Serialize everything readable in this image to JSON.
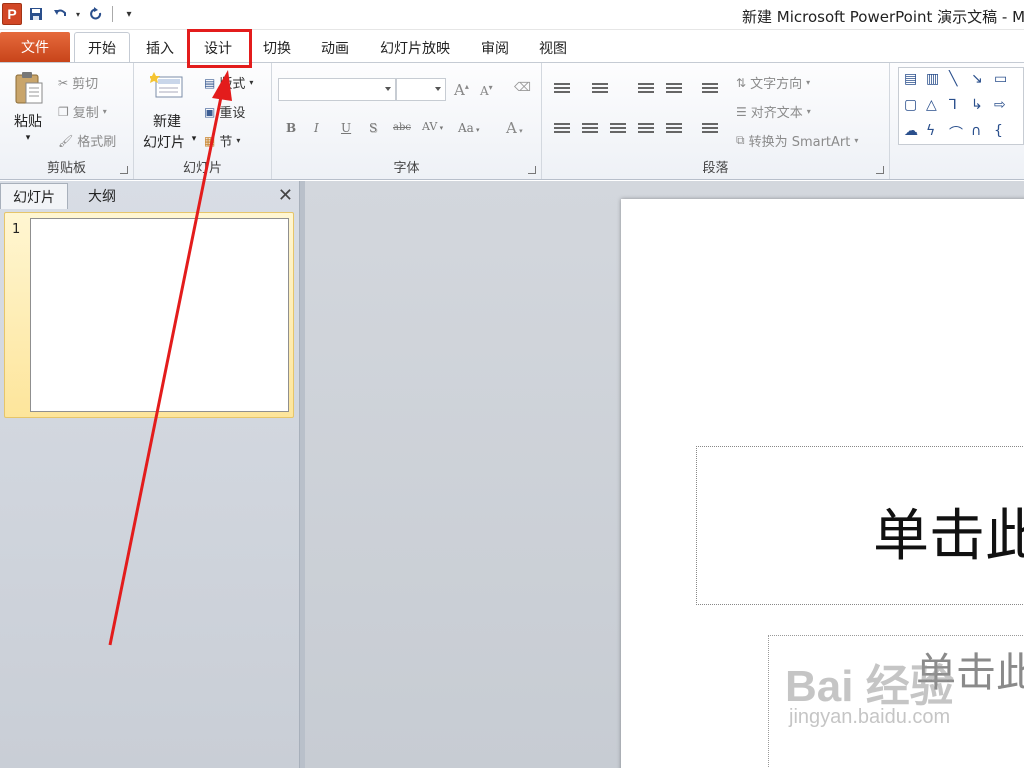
{
  "window": {
    "title": "新建 Microsoft PowerPoint 演示文稿 - M",
    "app_logo": "P"
  },
  "quick_access": {
    "icons": [
      "save-icon",
      "undo-icon",
      "redo-icon",
      "customize-icon"
    ]
  },
  "tabs": {
    "file": "文件",
    "items": [
      "开始",
      "插入",
      "设计",
      "切换",
      "动画",
      "幻灯片放映",
      "审阅",
      "视图"
    ],
    "active": "开始",
    "highlighted": "设计"
  },
  "ribbon": {
    "clipboard": {
      "label": "剪贴板",
      "paste": "粘贴",
      "cut": "剪切",
      "copy": "复制",
      "format_painter": "格式刷"
    },
    "slides": {
      "label": "幻灯片",
      "new_slide_line1": "新建",
      "new_slide_line2": "幻灯片",
      "layout": "版式",
      "reset": "重设",
      "section": "节"
    },
    "font": {
      "label": "字体",
      "font_name": "",
      "font_size": "",
      "bold": "B",
      "italic": "I",
      "underline": "U",
      "shadow": "S",
      "strikethrough": "abc",
      "char_spacing": "AV",
      "change_case": "Aa",
      "font_color": "A",
      "grow": "A",
      "shrink": "A"
    },
    "paragraph": {
      "label": "段落",
      "text_direction": "文字方向",
      "align_text": "对齐文本",
      "convert_smartart": "转换为 SmartArt"
    }
  },
  "left_panel": {
    "tab_slides": "幻灯片",
    "tab_outline": "大纲",
    "slide_number": "1"
  },
  "slide": {
    "title_placeholder": "单击此",
    "subtitle_placeholder": "单击此"
  },
  "watermark": {
    "main": "Bai 经验",
    "sub": "jingyan.baidu.com"
  },
  "colors": {
    "file_tab": "#d24726",
    "annotation": "#e31c1c"
  }
}
